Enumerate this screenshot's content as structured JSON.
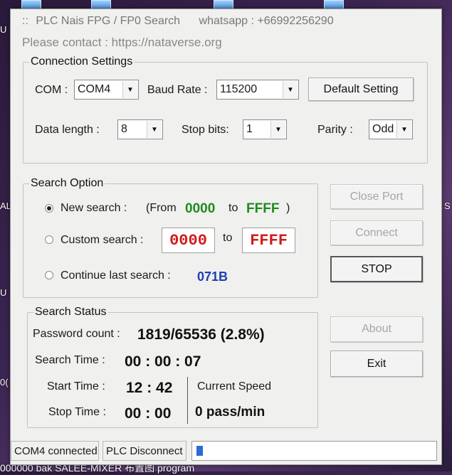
{
  "window": {
    "title_dots": "::",
    "title": "PLC Nais FPG / FP0 Search",
    "whatsapp": "whatsapp : +66992256290",
    "contact": "Please contact : https://nataverse.org"
  },
  "connection": {
    "legend": "Connection Settings",
    "com_label": "COM :",
    "com_value": "COM4",
    "baud_label": "Baud Rate :",
    "baud_value": "115200",
    "default_btn": "Default Setting",
    "datalen_label": "Data length :",
    "datalen_value": "8",
    "stopbits_label": "Stop bits:",
    "stopbits_value": "1",
    "parity_label": "Parity :",
    "parity_value": "Odd"
  },
  "search_option": {
    "legend": "Search Option",
    "new_label": "New search :",
    "from_open": "(From",
    "from_value": "0000",
    "to_word": "to",
    "to_value": "FFFF",
    "close_paren": ")",
    "custom_label": "Custom search :",
    "custom_from": "0000",
    "custom_to_word": "to",
    "custom_to": "FFFF",
    "continue_label": "Continue last search :",
    "last_value": "071B",
    "selected": "new"
  },
  "buttons": {
    "close_port": "Close Port",
    "connect": "Connect",
    "stop": "STOP",
    "about": "About",
    "exit": "Exit"
  },
  "status": {
    "legend": "Search Status",
    "pw_label": "Password count :",
    "pw_value": "1819/65536 (2.8%)",
    "time_label": "Search Time :",
    "time_value": "00 : 00 : 07",
    "start_label": "Start Time :",
    "start_value": "12 : 42",
    "stop_label": "Stop Time :",
    "stop_value": "00 : 00",
    "speed_label": "Current Speed",
    "speed_value": "0 pass/min"
  },
  "statusbar": {
    "com_status": "COM4 connected",
    "plc_status": "PLC Disconnect",
    "progress_fraction": 0.028
  },
  "desktop": {
    "bottom_text": "000000 bak SALEE-MIXER      布置图           program",
    "left_letters": [
      "U",
      "AL",
      "U",
      "0("
    ],
    "right_letters": [
      "S"
    ]
  }
}
